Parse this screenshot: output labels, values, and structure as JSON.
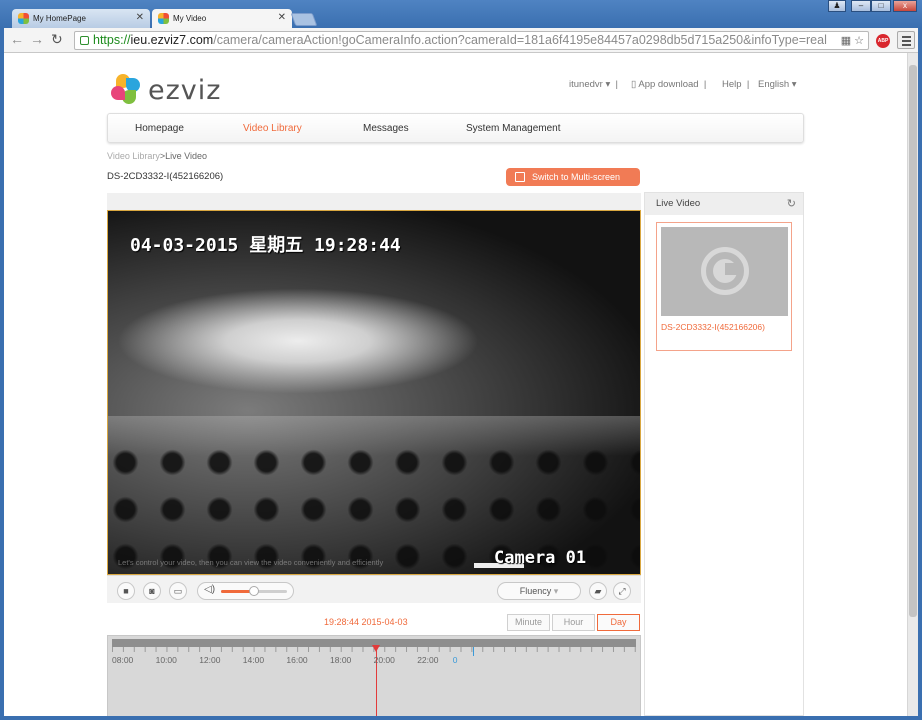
{
  "browser": {
    "tabs": [
      {
        "title": "My HomePage",
        "active": false
      },
      {
        "title": "My Video",
        "active": true
      }
    ],
    "url": {
      "scheme": "https://",
      "host": "ieu.ezviz7.com",
      "path": "/camera/cameraAction!goCameraInfo.action?cameraId=181a6f4195e84457a0298db5d715a250&infoType=real"
    },
    "extension_label": "ABP",
    "window_controls": [
      "person",
      "minimize",
      "maximize",
      "close"
    ]
  },
  "header": {
    "logo_text": "ezviz",
    "user": "itunedvr",
    "app_download": "App download",
    "help": "Help",
    "language": "English"
  },
  "nav": {
    "items": [
      "Homepage",
      "Video Library",
      "Messages",
      "System Management"
    ],
    "active": "Video Library"
  },
  "breadcrumb": {
    "parent": "Video Library",
    "separator": ">",
    "current": "Live Video"
  },
  "device": {
    "name": "DS-2CD3332-I(452166206)"
  },
  "buttons": {
    "multi_screen": "Switch to Multi-screen"
  },
  "video": {
    "osd_time": "04-03-2015 星期五 19:28:44",
    "osd_camera": "Camera 01",
    "subtitle": "Let's control your video, then you can view the video conveniently and efficiently"
  },
  "controls": {
    "fluency": "Fluency",
    "volume_level": 0.5
  },
  "playback": {
    "current_time": "19:28:44 2015-04-03",
    "ranges": [
      "Minute",
      "Hour",
      "Day"
    ],
    "active_range": "Day",
    "timeline_labels": [
      "08:00",
      "10:00",
      "12:00",
      "14:00",
      "16:00",
      "18:00",
      "20:00",
      "22:00",
      "0"
    ]
  },
  "sidebar": {
    "title": "Live Video",
    "cameras": [
      {
        "name": "DS-2CD3332-I(452166206)"
      }
    ]
  },
  "colors": {
    "accent": "#f06a3b",
    "chrome": "#3a6fb0"
  }
}
